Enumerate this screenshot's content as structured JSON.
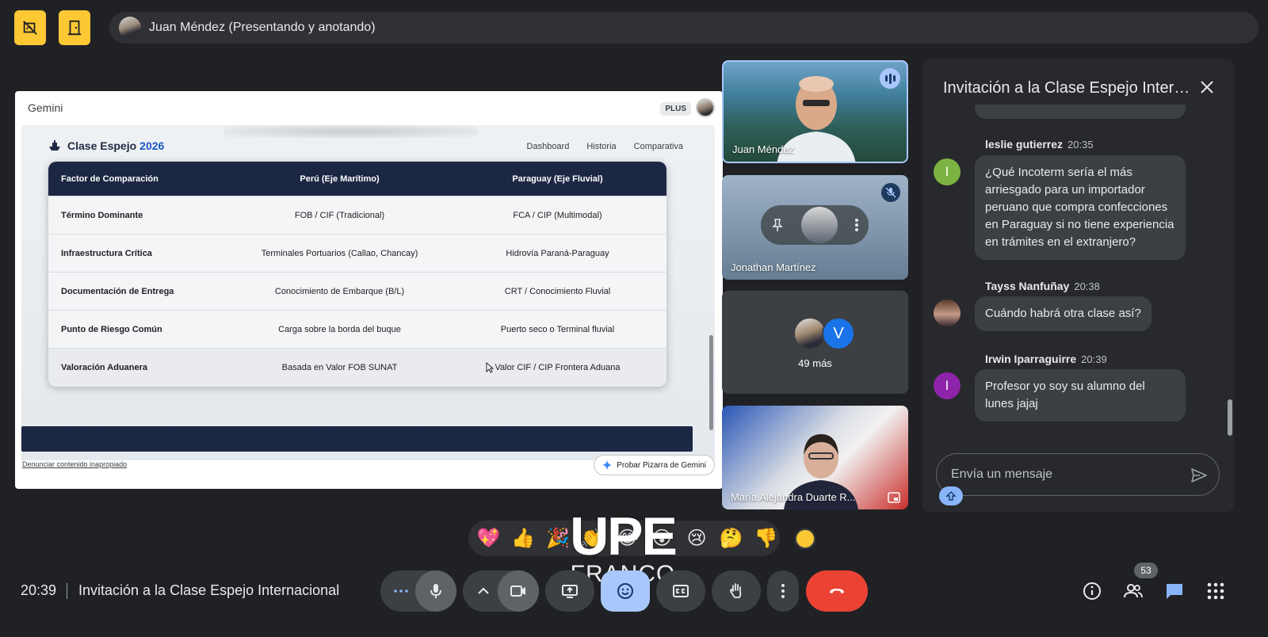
{
  "presenter": {
    "label": "Juan Méndez (Presentando y anotando)"
  },
  "screen": {
    "app_title": "Gemini",
    "plus_badge": "PLUS",
    "site": {
      "logo_text": "Clase Espejo",
      "logo_year": "2026",
      "nav": [
        "Dashboard",
        "Historia",
        "Comparativa"
      ]
    },
    "table": {
      "headers": [
        "Factor de Comparación",
        "Perú (Eje Marítimo)",
        "Paraguay (Eje Fluvial)"
      ],
      "rows": [
        [
          "Término Dominante",
          "FOB / CIF (Tradicional)",
          "FCA / CIP (Multimodal)"
        ],
        [
          "Infraestructura Crítica",
          "Terminales Portuarios (Callao, Chancay)",
          "Hidrovía Paraná-Paraguay"
        ],
        [
          "Documentación de Entrega",
          "Conocimiento de Embarque (B/L)",
          "CRT / Conocimiento Fluvial"
        ],
        [
          "Punto de Riesgo Común",
          "Carga sobre la borda del buque",
          "Puerto seco o Terminal fluvial"
        ],
        [
          "Valoración Aduanera",
          "Basada en Valor FOB SUNAT",
          "Valor CIF / CIP Frontera Aduana"
        ]
      ]
    },
    "report_link": "Denunciar contenido inapropiado",
    "try_button": "Probar Pizarra de Gemini"
  },
  "tiles": {
    "t1_name": "Juan Méndez",
    "t2_name": "Jonathan Martínez",
    "t3_more": "49 más",
    "t3_initial": "V",
    "t4_name": "María Alejandra Duarte R..."
  },
  "chat": {
    "title": "Invitación a la Clase Espejo Intern...",
    "messages": [
      {
        "author": "leslie gutierrez",
        "time": "20:35",
        "initial": "I",
        "text": "¿Qué Incoterm sería el más arriesgado para un importador peruano que compra confecciones en Paraguay si no tiene experiencia en trámites en el extranjero?"
      },
      {
        "author": "Tayss Nanfuñay",
        "time": "20:38",
        "initial": "",
        "text": "Cuándo habrá otra clase así?"
      },
      {
        "author": "Irwin Iparraguirre",
        "time": "20:39",
        "initial": "I",
        "text": "Profesor yo soy su alumno del lunes jajaj"
      }
    ],
    "input_placeholder": "Envía un mensaje"
  },
  "reactions": [
    "💖",
    "👍",
    "🎉",
    "👏",
    "😂",
    "😮",
    "😢",
    "🤔",
    "👎"
  ],
  "watermark": {
    "line1": "UPE",
    "line2": "FRANCO"
  },
  "bottom": {
    "time": "20:39",
    "meeting_title": "Invitación a la Clase Espejo Internacional",
    "people_count": "53"
  },
  "colors": {
    "bg": "#202124",
    "panel": "#28292c",
    "accent_yellow": "#fcc934",
    "accent_blue": "#a8c7fa",
    "end_call_red": "#ea4335",
    "table_header": "#1c2743"
  }
}
